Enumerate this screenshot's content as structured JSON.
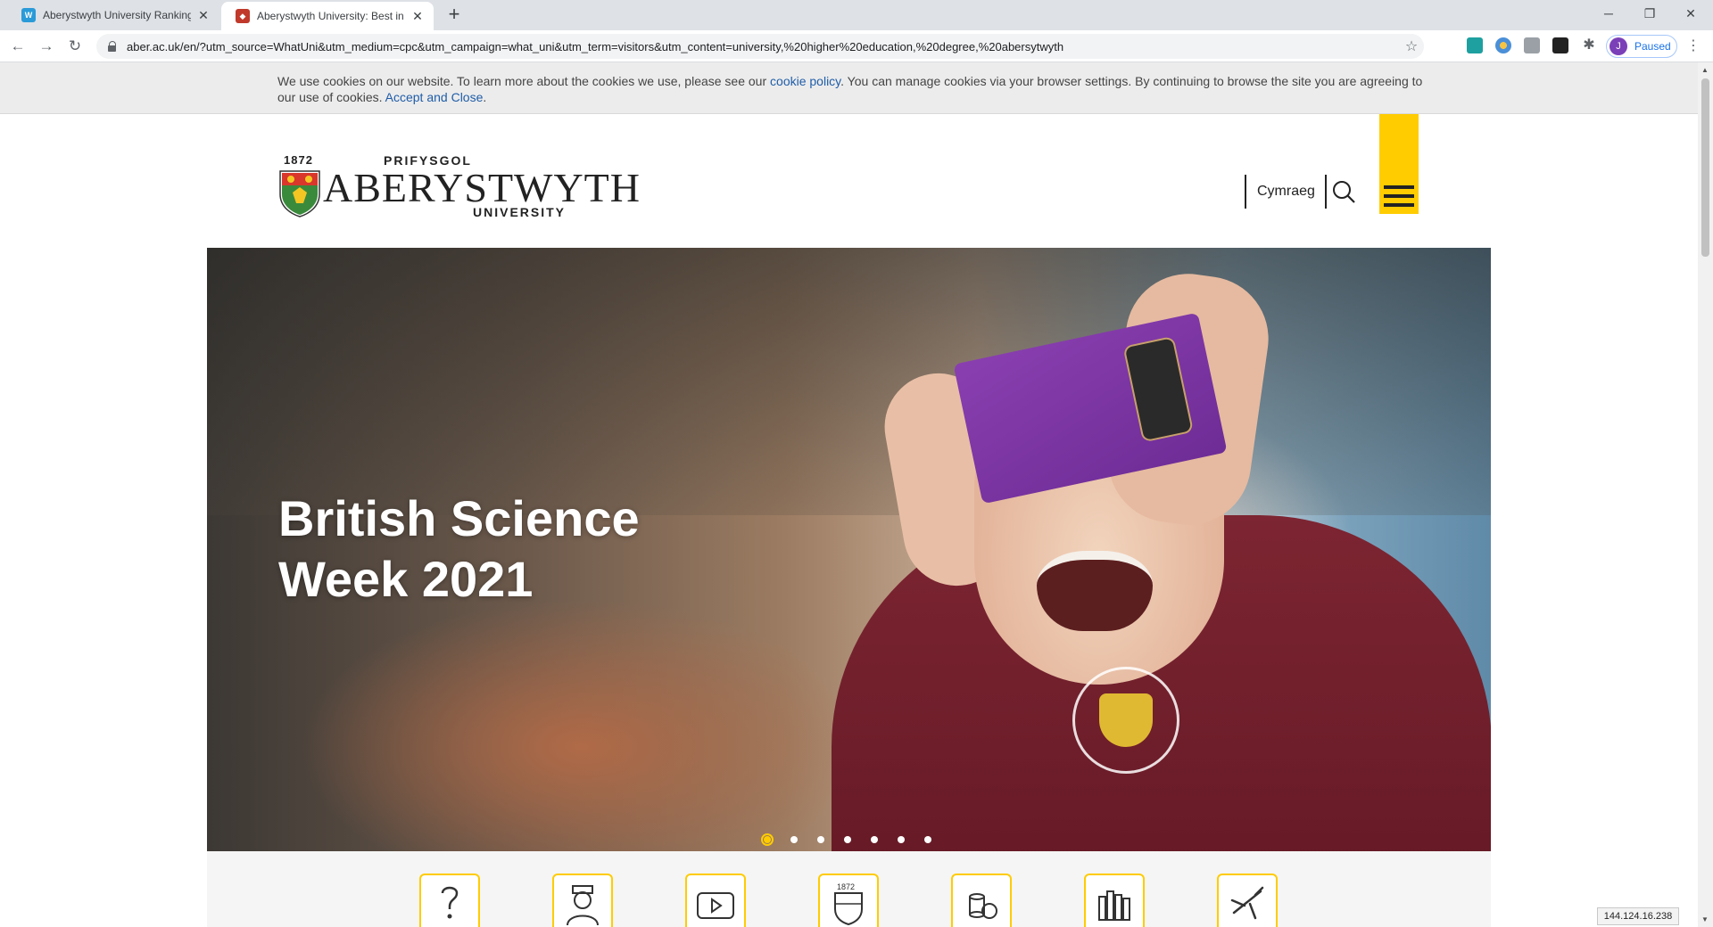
{
  "browser": {
    "tabs": [
      {
        "title": "Aberystwyth University Ranking &",
        "favicon": "whatuni-favicon",
        "active": false
      },
      {
        "title": "Aberystwyth University: Best in th",
        "favicon": "aber-crest-favicon",
        "active": true
      }
    ],
    "new_tab_icon": "plus-icon",
    "url": "aber.ac.uk/en/?utm_source=WhatUni&utm_medium=cpc&utm_campaign=what_uni&utm_term=visitors&utm_content=university,%20higher%20education,%20degree,%20abersytwyth",
    "profile_initial": "J",
    "profile_status": "Paused"
  },
  "cookie_banner": {
    "text_1": "We use cookies on our website. To learn more about the cookies we use, please see our ",
    "link_policy": "cookie policy",
    "text_2": ". You can manage cookies via your browser settings. By continuing to browse the site you are agreeing to our use of cookies. ",
    "link_accept": "Accept and Close",
    "text_3": "."
  },
  "header": {
    "logo": {
      "year": "1872",
      "top": "PRIFYSGOL",
      "main": "ABERYSTWYTH",
      "bottom": "UNIVERSITY"
    },
    "language_link": "Cymraeg",
    "search_icon": "search-icon",
    "menu_icon": "hamburger-menu-icon"
  },
  "hero": {
    "title_line1": "British Science",
    "title_line2": "Week 2021",
    "slide_count": 7,
    "active_slide": 1
  },
  "quick_links": [
    {
      "icon": "question-icon"
    },
    {
      "icon": "graduate-person-icon"
    },
    {
      "icon": "video-play-icon"
    },
    {
      "icon": "university-crest-icon"
    },
    {
      "icon": "coins-icon"
    },
    {
      "icon": "books-icon"
    },
    {
      "icon": "airplane-icon"
    }
  ],
  "ip_address": "144.124.16.238",
  "colors": {
    "brand_yellow": "#ffcc00",
    "link_blue": "#1f5da8",
    "sweater_maroon": "#7d2532"
  }
}
